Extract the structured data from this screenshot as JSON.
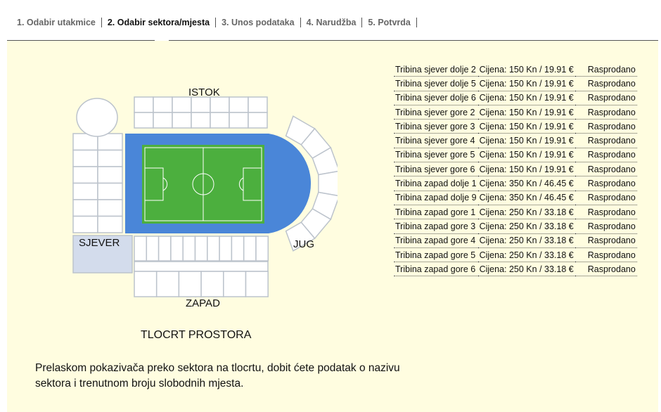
{
  "steps": [
    {
      "label": "1. Odabir utakmice",
      "active": false
    },
    {
      "label": "2. Odabir sektora/mjesta",
      "active": true
    },
    {
      "label": "3. Unos podataka",
      "active": false
    },
    {
      "label": "4. Narudžba",
      "active": false
    },
    {
      "label": "5. Potvrda",
      "active": false
    }
  ],
  "map": {
    "labels": {
      "istok": "ISTOK",
      "sjever": "SJEVER",
      "jug": "JUG",
      "zapad": "ZAPAD"
    },
    "title": "TLOCRT PROSTORA"
  },
  "legend": "Prelaskom pokazivača preko sektora na tlocrtu, dobit ćete podatak o nazivu sektora i trenutnom broju slobodnih mjesta.",
  "tickets": [
    {
      "name": "Tribina sjever dolje 2",
      "price": "Cijena: 150 Kn  / 19.91 €",
      "status": "Rasprodano"
    },
    {
      "name": "Tribina sjever dolje 5",
      "price": "Cijena: 150 Kn  / 19.91 €",
      "status": "Rasprodano"
    },
    {
      "name": "Tribina sjever dolje 6",
      "price": "Cijena: 150 Kn  / 19.91 €",
      "status": "Rasprodano"
    },
    {
      "name": "Tribina sjever gore 2",
      "price": "Cijena: 150 Kn  / 19.91 €",
      "status": "Rasprodano"
    },
    {
      "name": "Tribina sjever gore 3",
      "price": "Cijena: 150 Kn  / 19.91 €",
      "status": "Rasprodano"
    },
    {
      "name": "Tribina sjever gore 4",
      "price": "Cijena: 150 Kn  / 19.91 €",
      "status": "Rasprodano"
    },
    {
      "name": "Tribina sjever gore 5",
      "price": "Cijena: 150 Kn  / 19.91 €",
      "status": "Rasprodano"
    },
    {
      "name": "Tribina sjever gore 6",
      "price": "Cijena: 150 Kn  / 19.91 €",
      "status": "Rasprodano"
    },
    {
      "name": "Tribina zapad dolje 1",
      "price": "Cijena: 350 Kn  / 46.45 €",
      "status": "Rasprodano"
    },
    {
      "name": "Tribina zapad dolje 9",
      "price": "Cijena: 350 Kn  / 46.45 €",
      "status": "Rasprodano"
    },
    {
      "name": "Tribina zapad gore 1",
      "price": "Cijena: 250 Kn  / 33.18 €",
      "status": "Rasprodano"
    },
    {
      "name": "Tribina zapad gore 3",
      "price": "Cijena: 250 Kn  / 33.18 €",
      "status": "Rasprodano"
    },
    {
      "name": "Tribina zapad gore 4",
      "price": "Cijena: 250 Kn  / 33.18 €",
      "status": "Rasprodano"
    },
    {
      "name": "Tribina zapad gore 5",
      "price": "Cijena: 250 Kn  / 33.18 €",
      "status": "Rasprodano"
    },
    {
      "name": "Tribina zapad gore 6",
      "price": "Cijena: 250 Kn  / 33.18 €",
      "status": "Rasprodano"
    }
  ],
  "colors": {
    "panel_bg": "#fffde0",
    "sector_fill": "#ffffff",
    "sector_stroke": "#bcc3cc",
    "track": "#4a86d8",
    "pitch": "#4caf3e",
    "selected_sector": "#d3dcec"
  }
}
